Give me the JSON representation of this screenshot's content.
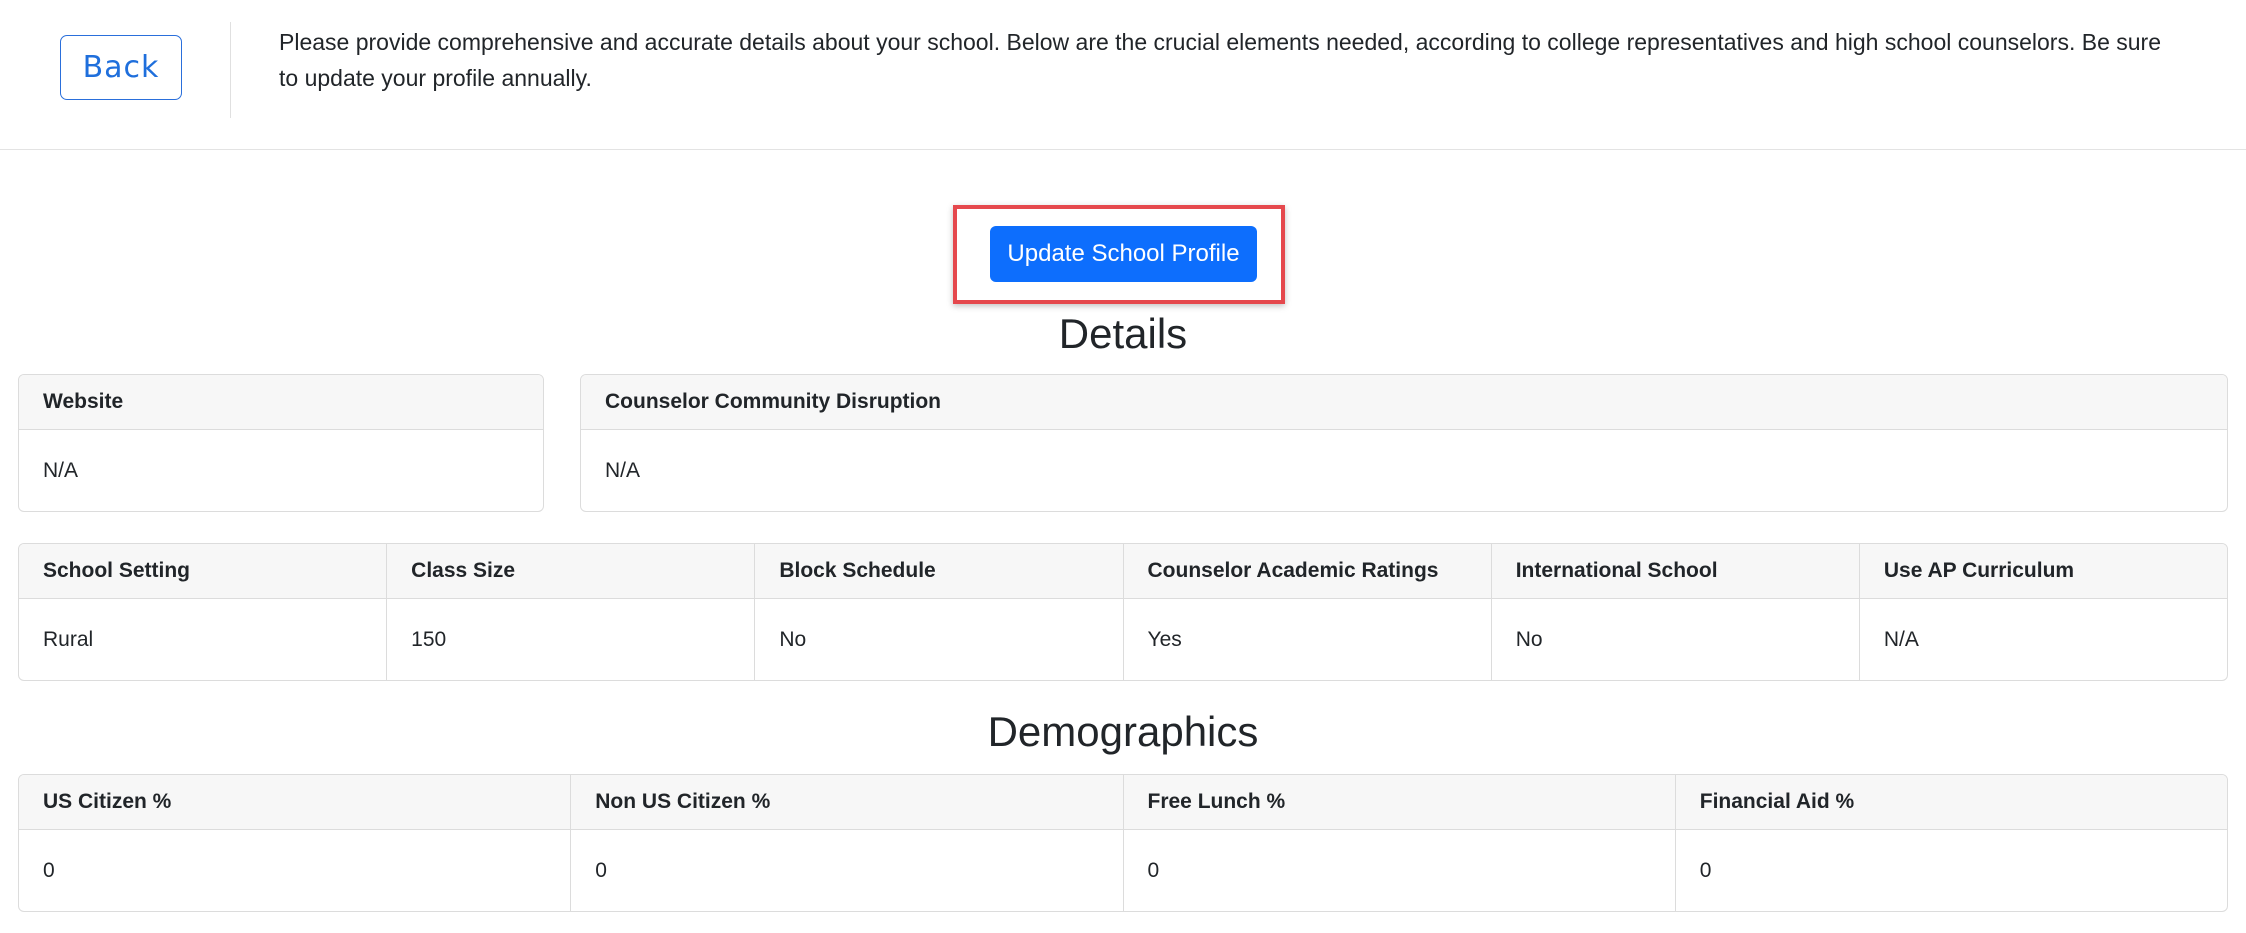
{
  "header": {
    "back_label": "Back",
    "intro": "Please provide comprehensive and accurate details about your school. Below are the crucial elements needed, according to college representatives and high school counselors. Be sure to update your profile annually."
  },
  "actions": {
    "update_label": "Update School Profile"
  },
  "details": {
    "title": "Details",
    "website": {
      "label": "Website",
      "value": "N/A"
    },
    "disruption": {
      "label": "Counselor Community Disruption",
      "value": "N/A"
    },
    "fields": [
      {
        "label": "School Setting",
        "value": "Rural"
      },
      {
        "label": "Class Size",
        "value": "150"
      },
      {
        "label": "Block Schedule",
        "value": "No"
      },
      {
        "label": "Counselor Academic Ratings",
        "value": "Yes"
      },
      {
        "label": "International School",
        "value": "No"
      },
      {
        "label": "Use AP Curriculum",
        "value": "N/A"
      }
    ]
  },
  "demographics": {
    "title": "Demographics",
    "fields": [
      {
        "label": "US Citizen %",
        "value": "0"
      },
      {
        "label": "Non US Citizen %",
        "value": "0"
      },
      {
        "label": "Free Lunch %",
        "value": "0"
      },
      {
        "label": "Financial Aid %",
        "value": "0"
      }
    ]
  },
  "colors": {
    "primary": "#0d6efd",
    "highlight": "#e5484d",
    "border": "#dcdcdc",
    "header_bg": "#f7f7f7"
  }
}
